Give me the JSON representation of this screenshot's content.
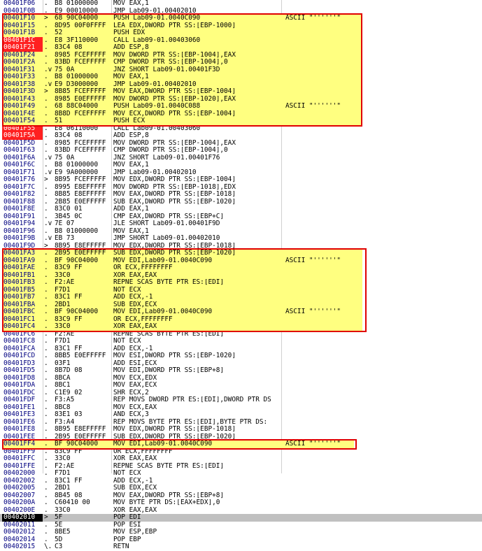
{
  "colors": {
    "address": "#000080",
    "highlight_fill": "#ffff80",
    "box_border": "#e00000",
    "marked_address_bg": "#ff2020",
    "current_address_bg": "#000000",
    "selected_row_bg": "#c0c0c0"
  },
  "rows": [
    {
      "addr": "00401F06",
      "arrow": ".",
      "bytes": "B8 01000000",
      "instr": "MOV EAX,1",
      "comment": ""
    },
    {
      "addr": "00401F0B",
      "arrow": ".",
      "bytes": "E9 00010000",
      "instr": "JMP Lab09-01.00402010",
      "comment": ""
    },
    {
      "addr": "00401F10",
      "arrow": ">",
      "bytes": "68 90C04000",
      "instr": "PUSH Lab09-01.0040C090",
      "comment": "ASCII \"''''''\""
    },
    {
      "addr": "00401F15",
      "arrow": ".",
      "bytes": "8D95 00F0FFFF",
      "instr": "LEA EDX,DWORD PTR SS:[EBP-1000]",
      "comment": ""
    },
    {
      "addr": "00401F1B",
      "arrow": ".",
      "bytes": "52",
      "instr": "PUSH EDX",
      "comment": ""
    },
    {
      "addr": "00401F1C",
      "arrow": ".",
      "bytes": "E8 3F110000",
      "instr": "CALL Lab09-01.00403060",
      "comment": ""
    },
    {
      "addr": "00401F21",
      "arrow": ".",
      "bytes": "83C4 08",
      "instr": "ADD ESP,8",
      "comment": ""
    },
    {
      "addr": "00401F24",
      "arrow": ".",
      "bytes": "8985 FCEFFFFF",
      "instr": "MOV DWORD PTR SS:[EBP-1004],EAX",
      "comment": ""
    },
    {
      "addr": "00401F2A",
      "arrow": ".",
      "bytes": "83BD FCEFFFFF",
      "instr": "CMP DWORD PTR SS:[EBP-1004],0",
      "comment": ""
    },
    {
      "addr": "00401F31",
      "arrow": ".v",
      "bytes": "75 0A",
      "instr": "JNZ SHORT Lab09-01.00401F3D",
      "comment": ""
    },
    {
      "addr": "00401F33",
      "arrow": ".",
      "bytes": "B8 01000000",
      "instr": "MOV EAX,1",
      "comment": ""
    },
    {
      "addr": "00401F38",
      "arrow": ".v",
      "bytes": "E9 D3000000",
      "instr": "JMP Lab09-01.00402010",
      "comment": ""
    },
    {
      "addr": "00401F3D",
      "arrow": ">",
      "bytes": "8B85 FCEFFFFF",
      "instr": "MOV EAX,DWORD PTR SS:[EBP-1004]",
      "comment": ""
    },
    {
      "addr": "00401F43",
      "arrow": ".",
      "bytes": "8985 E0EFFFFF",
      "instr": "MOV DWORD PTR SS:[EBP-1020],EAX",
      "comment": ""
    },
    {
      "addr": "00401F49",
      "arrow": ".",
      "bytes": "68 88C04000",
      "instr": "PUSH Lab09-01.0040C088",
      "comment": "ASCII \"''''''\""
    },
    {
      "addr": "00401F4E",
      "arrow": ".",
      "bytes": "8B8D FCEFFFFF",
      "instr": "MOV ECX,DWORD PTR SS:[EBP-1004]",
      "comment": ""
    },
    {
      "addr": "00401F54",
      "arrow": ".",
      "bytes": "51",
      "instr": "PUSH ECX",
      "comment": ""
    },
    {
      "addr": "00401F55",
      "arrow": ".",
      "bytes": "E8 06110000",
      "instr": "CALL Lab09-01.00403060",
      "comment": ""
    },
    {
      "addr": "00401F5A",
      "arrow": ".",
      "bytes": "83C4 08",
      "instr": "ADD ESP,8",
      "comment": ""
    },
    {
      "addr": "00401F5D",
      "arrow": ".",
      "bytes": "8985 FCEFFFFF",
      "instr": "MOV DWORD PTR SS:[EBP-1004],EAX",
      "comment": ""
    },
    {
      "addr": "00401F63",
      "arrow": ".",
      "bytes": "83BD FCEFFFFF",
      "instr": "CMP DWORD PTR SS:[EBP-1004],0",
      "comment": ""
    },
    {
      "addr": "00401F6A",
      "arrow": ".v",
      "bytes": "75 0A",
      "instr": "JNZ SHORT Lab09-01.00401F76",
      "comment": ""
    },
    {
      "addr": "00401F6C",
      "arrow": ".",
      "bytes": "B8 01000000",
      "instr": "MOV EAX,1",
      "comment": ""
    },
    {
      "addr": "00401F71",
      "arrow": ".v",
      "bytes": "E9 9A000000",
      "instr": "JMP Lab09-01.00402010",
      "comment": ""
    },
    {
      "addr": "00401F76",
      "arrow": ">",
      "bytes": "8B95 FCEFFFFF",
      "instr": "MOV EDX,DWORD PTR SS:[EBP-1004]",
      "comment": ""
    },
    {
      "addr": "00401F7C",
      "arrow": ".",
      "bytes": "8995 E8EFFFFF",
      "instr": "MOV DWORD PTR SS:[EBP-1018],EDX",
      "comment": ""
    },
    {
      "addr": "00401F82",
      "arrow": ".",
      "bytes": "8B85 E8EFFFFF",
      "instr": "MOV EAX,DWORD PTR SS:[EBP-1018]",
      "comment": ""
    },
    {
      "addr": "00401F88",
      "arrow": ".",
      "bytes": "2B85 E0EFFFFF",
      "instr": "SUB EAX,DWORD PTR SS:[EBP-1020]",
      "comment": ""
    },
    {
      "addr": "00401F8E",
      "arrow": ".",
      "bytes": "83C0 01",
      "instr": "ADD EAX,1",
      "comment": ""
    },
    {
      "addr": "00401F91",
      "arrow": ".",
      "bytes": "3B45 0C",
      "instr": "CMP EAX,DWORD PTR SS:[EBP+C]",
      "comment": ""
    },
    {
      "addr": "00401F94",
      "arrow": ".v",
      "bytes": "7E 07",
      "instr": "JLE SHORT Lab09-01.00401F9D",
      "comment": ""
    },
    {
      "addr": "00401F96",
      "arrow": ".",
      "bytes": "B8 01000000",
      "instr": "MOV EAX,1",
      "comment": ""
    },
    {
      "addr": "00401F9B",
      "arrow": ".v",
      "bytes": "EB 73",
      "instr": "JMP SHORT Lab09-01.00402010",
      "comment": ""
    },
    {
      "addr": "00401F9D",
      "arrow": ">",
      "bytes": "8B95 E8EFFFFF",
      "instr": "MOV EDX,DWORD PTR SS:[EBP-1018]",
      "comment": ""
    },
    {
      "addr": "00401FA3",
      "arrow": ".",
      "bytes": "2B95 E0EFFFFF",
      "instr": "SUB EDX,DWORD PTR SS:[EBP-1020]",
      "comment": ""
    },
    {
      "addr": "00401FA9",
      "arrow": ".",
      "bytes": "BF 90C04000",
      "instr": "MOV EDI,Lab09-01.0040C090",
      "comment": "ASCII \"''''''\""
    },
    {
      "addr": "00401FAE",
      "arrow": ".",
      "bytes": "83C9 FF",
      "instr": "OR ECX,FFFFFFFF",
      "comment": ""
    },
    {
      "addr": "00401FB1",
      "arrow": ".",
      "bytes": "33C0",
      "instr": "XOR EAX,EAX",
      "comment": ""
    },
    {
      "addr": "00401FB3",
      "arrow": ".",
      "bytes": "F2:AE",
      "instr": "REPNE SCAS BYTE PTR ES:[EDI]",
      "comment": ""
    },
    {
      "addr": "00401FB5",
      "arrow": ".",
      "bytes": "F7D1",
      "instr": "NOT ECX",
      "comment": ""
    },
    {
      "addr": "00401FB7",
      "arrow": ".",
      "bytes": "83C1 FF",
      "instr": "ADD ECX,-1",
      "comment": ""
    },
    {
      "addr": "00401FBA",
      "arrow": ".",
      "bytes": "2BD1",
      "instr": "SUB EDX,ECX",
      "comment": ""
    },
    {
      "addr": "00401FBC",
      "arrow": ".",
      "bytes": "BF 90C04000",
      "instr": "MOV EDI,Lab09-01.0040C090",
      "comment": "ASCII \"''''''\""
    },
    {
      "addr": "00401FC1",
      "arrow": ".",
      "bytes": "83C9 FF",
      "instr": "OR ECX,FFFFFFFF",
      "comment": ""
    },
    {
      "addr": "00401FC4",
      "arrow": ".",
      "bytes": "33C0",
      "instr": "XOR EAX,EAX",
      "comment": ""
    },
    {
      "addr": "00401FC6",
      "arrow": ".",
      "bytes": "F2:AE",
      "instr": "REPNE SCAS BYTE PTR ES:[EDI]",
      "comment": ""
    },
    {
      "addr": "00401FC8",
      "arrow": ".",
      "bytes": "F7D1",
      "instr": "NOT ECX",
      "comment": ""
    },
    {
      "addr": "00401FCA",
      "arrow": ".",
      "bytes": "83C1 FF",
      "instr": "ADD ECX,-1",
      "comment": ""
    },
    {
      "addr": "00401FCD",
      "arrow": ".",
      "bytes": "8BB5 E0EFFFFF",
      "instr": "MOV ESI,DWORD PTR SS:[EBP-1020]",
      "comment": ""
    },
    {
      "addr": "00401FD3",
      "arrow": ".",
      "bytes": "03F1",
      "instr": "ADD ESI,ECX",
      "comment": ""
    },
    {
      "addr": "00401FD5",
      "arrow": ".",
      "bytes": "8B7D 08",
      "instr": "MOV EDI,DWORD PTR SS:[EBP+8]",
      "comment": ""
    },
    {
      "addr": "00401FD8",
      "arrow": ".",
      "bytes": "8BCA",
      "instr": "MOV ECX,EDX",
      "comment": ""
    },
    {
      "addr": "00401FDA",
      "arrow": ".",
      "bytes": "8BC1",
      "instr": "MOV EAX,ECX",
      "comment": ""
    },
    {
      "addr": "00401FDC",
      "arrow": ".",
      "bytes": "C1E9 02",
      "instr": "SHR ECX,2",
      "comment": ""
    },
    {
      "addr": "00401FDF",
      "arrow": ".",
      "bytes": "F3:A5",
      "instr": "REP MOVS DWORD PTR ES:[EDI],DWORD PTR DS",
      "comment": ""
    },
    {
      "addr": "00401FE1",
      "arrow": ".",
      "bytes": "8BC8",
      "instr": "MOV ECX,EAX",
      "comment": ""
    },
    {
      "addr": "00401FE3",
      "arrow": ".",
      "bytes": "83E1 03",
      "instr": "AND ECX,3",
      "comment": ""
    },
    {
      "addr": "00401FE6",
      "arrow": ".",
      "bytes": "F3:A4",
      "instr": "REP MOVS BYTE PTR ES:[EDI],BYTE PTR DS:",
      "comment": ""
    },
    {
      "addr": "00401FE8",
      "arrow": ".",
      "bytes": "8B95 E8EFFFFF",
      "instr": "MOV EDX,DWORD PTR SS:[EBP-1018]",
      "comment": ""
    },
    {
      "addr": "00401FEE",
      "arrow": ".",
      "bytes": "2B95 E0EFFFFF",
      "instr": "SUB EDX,DWORD PTR SS:[EBP-1020]",
      "comment": ""
    },
    {
      "addr": "00401FF4",
      "arrow": ".",
      "bytes": "BF 90C04000",
      "instr": "MOV EDI,Lab09-01.0040C090",
      "comment": "ASCII \"''''''\""
    },
    {
      "addr": "00401FF9",
      "arrow": ".",
      "bytes": "83C9 FF",
      "instr": "OR ECX,FFFFFFFF",
      "comment": ""
    },
    {
      "addr": "00401FFC",
      "arrow": ".",
      "bytes": "33C0",
      "instr": "XOR EAX,EAX",
      "comment": ""
    },
    {
      "addr": "00401FFE",
      "arrow": ".",
      "bytes": "F2:AE",
      "instr": "REPNE SCAS BYTE PTR ES:[EDI]",
      "comment": ""
    },
    {
      "addr": "00402000",
      "arrow": ".",
      "bytes": "F7D1",
      "instr": "NOT ECX",
      "comment": ""
    },
    {
      "addr": "00402002",
      "arrow": ".",
      "bytes": "83C1 FF",
      "instr": "ADD ECX,-1",
      "comment": ""
    },
    {
      "addr": "00402005",
      "arrow": ".",
      "bytes": "2BD1",
      "instr": "SUB EDX,ECX",
      "comment": ""
    },
    {
      "addr": "00402007",
      "arrow": ".",
      "bytes": "8B45 08",
      "instr": "MOV EAX,DWORD PTR SS:[EBP+8]",
      "comment": ""
    },
    {
      "addr": "0040200A",
      "arrow": ".",
      "bytes": "C60410 00",
      "instr": "MOV BYTE PTR DS:[EAX+EDX],0",
      "comment": ""
    },
    {
      "addr": "0040200E",
      "arrow": ".",
      "bytes": "33C0",
      "instr": "XOR EAX,EAX",
      "comment": ""
    },
    {
      "addr": "00402010",
      "arrow": ">",
      "bytes": "5F",
      "instr": "POP EDI",
      "comment": ""
    },
    {
      "addr": "00402011",
      "arrow": ".",
      "bytes": "5E",
      "instr": "POP ESI",
      "comment": ""
    },
    {
      "addr": "00402012",
      "arrow": ".",
      "bytes": "8BE5",
      "instr": "MOV ESP,EBP",
      "comment": ""
    },
    {
      "addr": "00402014",
      "arrow": ".",
      "bytes": "5D",
      "instr": "POP EBP",
      "comment": ""
    },
    {
      "addr": "00402015",
      "arrow": "\\.",
      "bytes": "C3",
      "instr": "RETN",
      "comment": ""
    }
  ]
}
